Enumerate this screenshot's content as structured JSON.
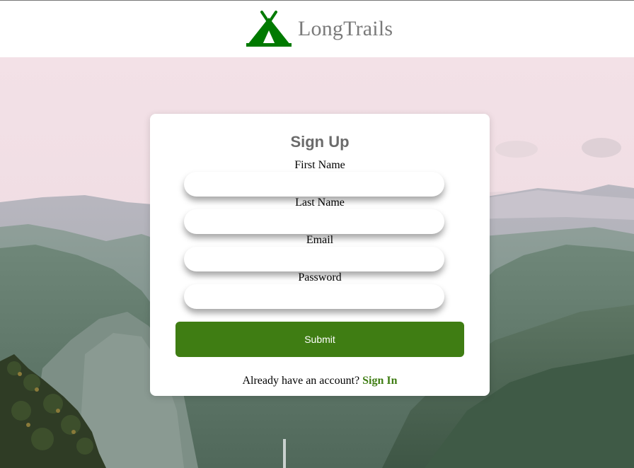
{
  "app": {
    "brand_name": "LongTrails",
    "logo_icon": "tent-icon",
    "brand_color": "#007a00"
  },
  "form": {
    "title": "Sign Up",
    "fields": [
      {
        "label": "First Name",
        "value": "",
        "placeholder": ""
      },
      {
        "label": "Last Name",
        "value": "",
        "placeholder": ""
      },
      {
        "label": "Email",
        "value": "",
        "placeholder": ""
      },
      {
        "label": "Password",
        "value": "",
        "placeholder": ""
      }
    ],
    "submit_label": "Submit",
    "submit_color": "#3f7d13"
  },
  "footer": {
    "prompt": "Already have an account?",
    "link_label": "Sign In"
  },
  "background": {
    "description_icon": "mountain-landscape-image"
  }
}
